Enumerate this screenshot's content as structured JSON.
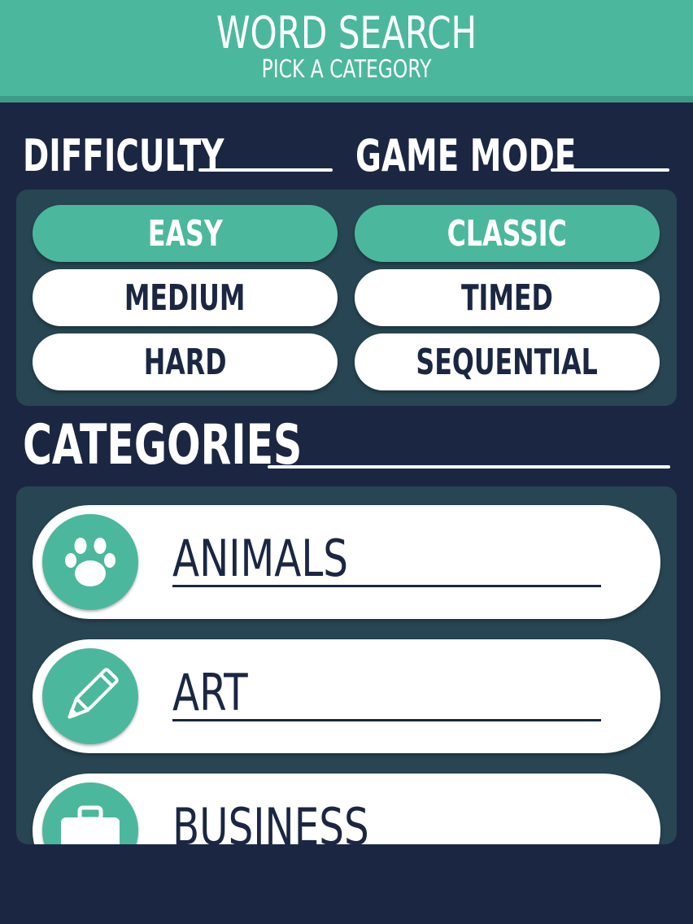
{
  "header": {
    "title": "WORD SEARCH",
    "subtitle": "PICK A CATEGORY"
  },
  "difficulty": {
    "heading": "DIFFICULTY",
    "options": [
      "EASY",
      "MEDIUM",
      "HARD"
    ],
    "selected": "EASY"
  },
  "game_mode": {
    "heading": "GAME MODE",
    "options": [
      "CLASSIC",
      "TIMED",
      "SEQUENTIAL"
    ],
    "selected": "CLASSIC"
  },
  "categories": {
    "heading": "CATEGORIES",
    "items": [
      {
        "label": "ANIMALS",
        "icon": "paw-icon"
      },
      {
        "label": "ART",
        "icon": "pencil-icon"
      },
      {
        "label": "BUSINESS",
        "icon": "briefcase-icon"
      }
    ]
  },
  "colors": {
    "accent": "#4bb89d",
    "background": "#1b2742",
    "panel": "#274552",
    "text_dark": "#1b2742"
  }
}
